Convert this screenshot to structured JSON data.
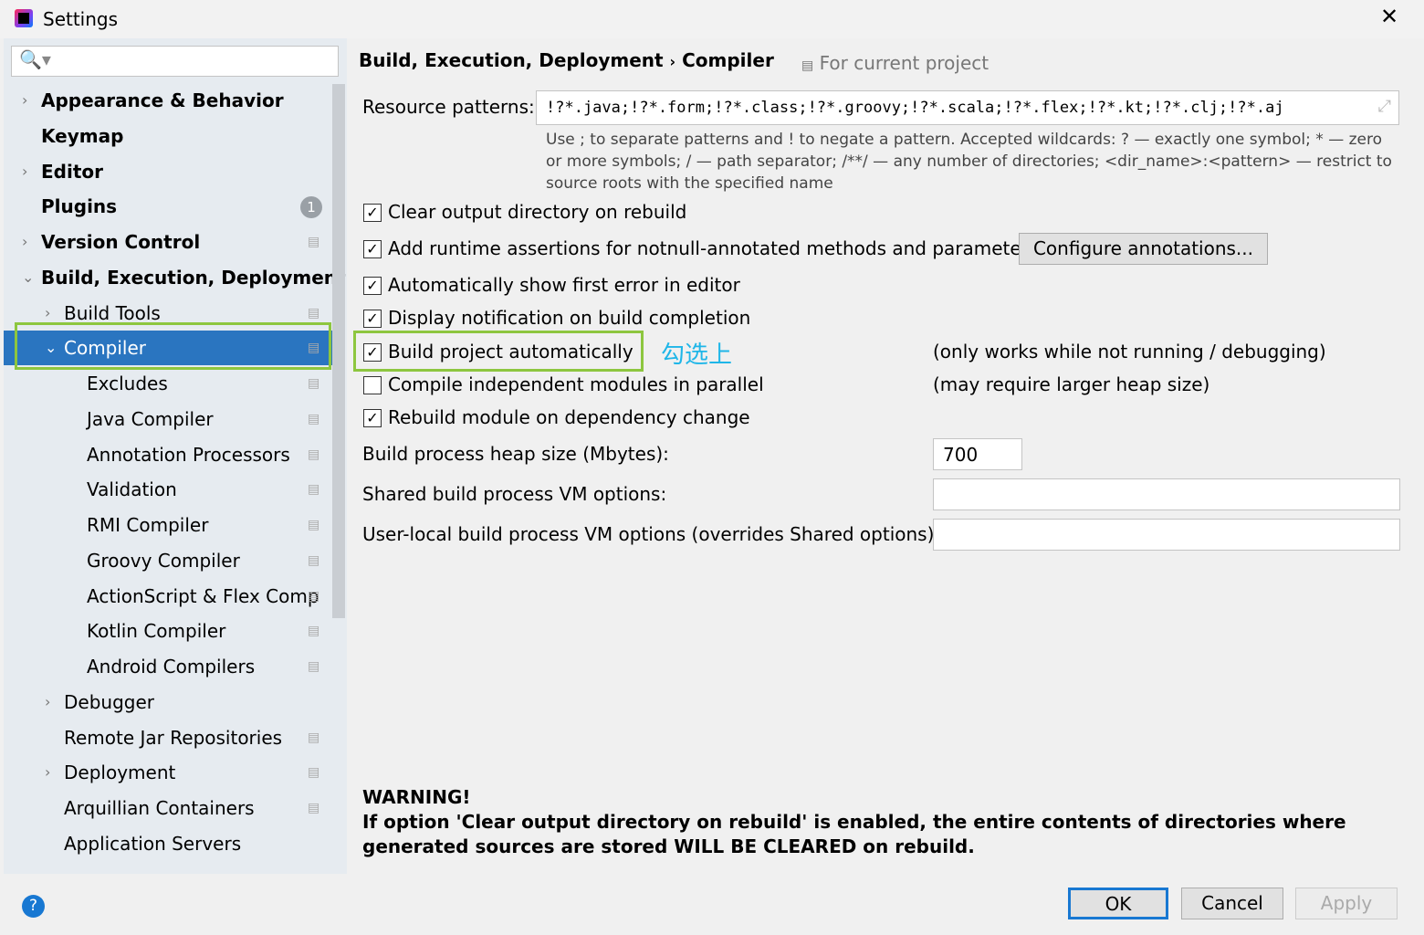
{
  "window": {
    "title": "Settings",
    "close": "✕"
  },
  "search": {
    "icon": "🔍▾",
    "placeholder": ""
  },
  "tree": [
    {
      "label": "Appearance & Behavior",
      "level": 0,
      "arrow": "›",
      "bold": true
    },
    {
      "label": "Keymap",
      "level": 0,
      "bold": true
    },
    {
      "label": "Editor",
      "level": 0,
      "arrow": "›",
      "bold": true
    },
    {
      "label": "Plugins",
      "level": 0,
      "bold": true,
      "badge": "1"
    },
    {
      "label": "Version Control",
      "level": 0,
      "arrow": "›",
      "bold": true,
      "project": true
    },
    {
      "label": "Build, Execution, Deployment",
      "level": 0,
      "arrow": "⌄",
      "bold": true
    },
    {
      "label": "Build Tools",
      "level": 1,
      "arrow": "›",
      "project": true
    },
    {
      "label": "Compiler",
      "level": 1,
      "arrow": "⌄",
      "project": true,
      "selected": true
    },
    {
      "label": "Excludes",
      "level": 2,
      "project": true
    },
    {
      "label": "Java Compiler",
      "level": 2,
      "project": true
    },
    {
      "label": "Annotation Processors",
      "level": 2,
      "project": true
    },
    {
      "label": "Validation",
      "level": 2,
      "project": true
    },
    {
      "label": "RMI Compiler",
      "level": 2,
      "project": true
    },
    {
      "label": "Groovy Compiler",
      "level": 2,
      "project": true
    },
    {
      "label": "ActionScript & Flex Comp",
      "level": 2,
      "project": true
    },
    {
      "label": "Kotlin Compiler",
      "level": 2,
      "project": true
    },
    {
      "label": "Android Compilers",
      "level": 2,
      "project": true
    },
    {
      "label": "Debugger",
      "level": 1,
      "arrow": "›"
    },
    {
      "label": "Remote Jar Repositories",
      "level": 1,
      "project": true
    },
    {
      "label": "Deployment",
      "level": 1,
      "arrow": "›",
      "project": true
    },
    {
      "label": "Arquillian Containers",
      "level": 1,
      "project": true
    },
    {
      "label": "Application Servers",
      "level": 1
    }
  ],
  "header": {
    "breadcrumb1": "Build, Execution, Deployment",
    "sep": "›",
    "breadcrumb2": "Compiler",
    "scope": "For current project"
  },
  "resource": {
    "label": "Resource patterns:",
    "value": "!?*.java;!?*.form;!?*.class;!?*.groovy;!?*.scala;!?*.flex;!?*.kt;!?*.clj;!?*.aj",
    "hint": "Use ; to separate patterns and ! to negate a pattern. Accepted wildcards: ? — exactly one symbol; * — zero or more symbols; / — path separator; /**/ — any number of directories; <dir_name>:<pattern> — restrict to source roots with the specified name"
  },
  "options": [
    {
      "label": "Clear output directory on rebuild",
      "checked": true
    },
    {
      "label": "Add runtime assertions for notnull-annotated methods and parameters",
      "checked": true
    },
    {
      "label": "Automatically show first error in editor",
      "checked": true
    },
    {
      "label": "Display notification on build completion",
      "checked": true
    },
    {
      "label": "Build project automatically",
      "checked": true,
      "note": "(only works while not running / debugging)"
    },
    {
      "label": "Compile independent modules in parallel",
      "checked": false,
      "note": "(may require larger heap size)"
    },
    {
      "label": "Rebuild module on dependency change",
      "checked": true
    }
  ],
  "configure_button": "Configure annotations...",
  "annotation": "勾选上",
  "heap": {
    "label": "Build process heap size (Mbytes):",
    "value": "700"
  },
  "shared_vm": {
    "label": "Shared build process VM options:",
    "value": ""
  },
  "user_vm": {
    "label": "User-local build process VM options (overrides Shared options):",
    "value": ""
  },
  "warning": {
    "title": "WARNING!",
    "text": "If option 'Clear output directory on rebuild' is enabled, the entire contents of directories where generated sources are stored WILL BE CLEARED on rebuild."
  },
  "footer": {
    "help": "?",
    "ok": "OK",
    "cancel": "Cancel",
    "apply": "Apply"
  },
  "colors": {
    "selection": "#2a75c0",
    "highlight_box": "#8dc63f",
    "annotation": "#1fb6e8"
  }
}
